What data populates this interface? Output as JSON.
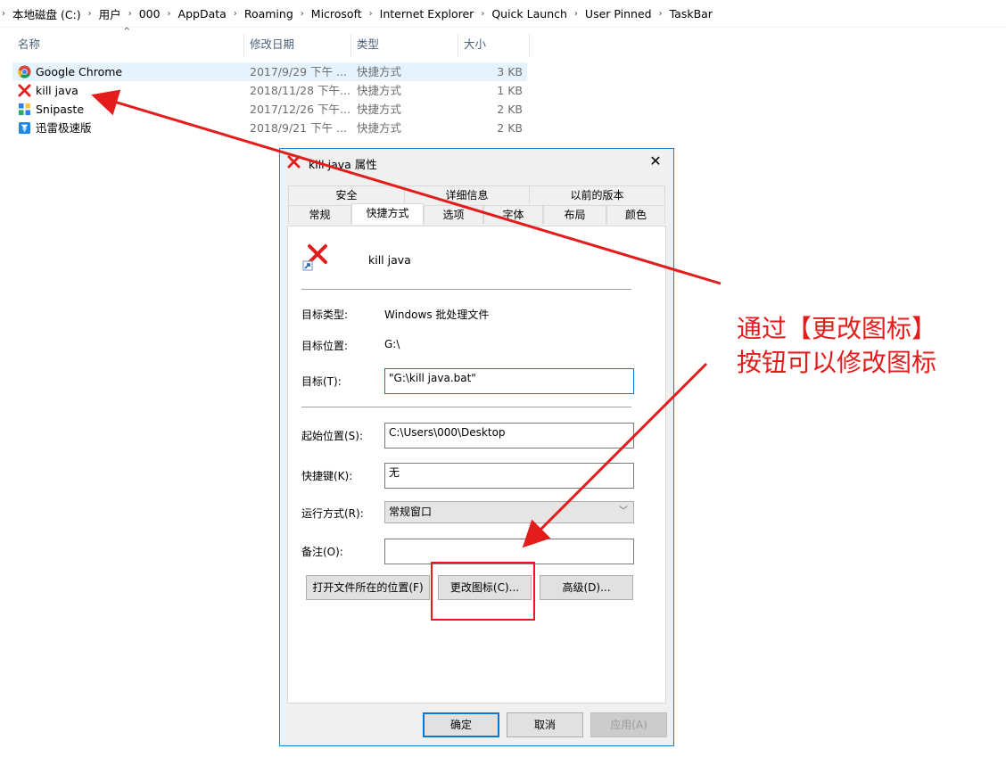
{
  "breadcrumb": [
    "本地磁盘 (C:)",
    "用户",
    "000",
    "AppData",
    "Roaming",
    "Microsoft",
    "Internet Explorer",
    "Quick Launch",
    "User Pinned",
    "TaskBar"
  ],
  "columns": {
    "name": "名称",
    "date": "修改日期",
    "type": "类型",
    "size": "大小"
  },
  "files": [
    {
      "name": "Google Chrome",
      "date": "2017/9/29 下午 ...",
      "type": "快捷方式",
      "size": "3 KB",
      "icon": "chrome-icon"
    },
    {
      "name": "kill java",
      "date": "2018/11/28 下午...",
      "type": "快捷方式",
      "size": "1 KB",
      "icon": "red-x-icon"
    },
    {
      "name": "Snipaste",
      "date": "2017/12/26 下午...",
      "type": "快捷方式",
      "size": "2 KB",
      "icon": "snipaste-icon"
    },
    {
      "name": "迅雷极速版",
      "date": "2018/9/21 下午 ...",
      "type": "快捷方式",
      "size": "2 KB",
      "icon": "xunlei-icon"
    }
  ],
  "dialog": {
    "title": "kill java 属性",
    "tabs_row1": [
      "安全",
      "详细信息",
      "以前的版本"
    ],
    "tabs_row2": [
      "常规",
      "快捷方式",
      "选项",
      "字体",
      "布局",
      "颜色"
    ],
    "active_tab": "快捷方式",
    "shortcut_name": "kill java",
    "target_type_label": "目标类型:",
    "target_type_value": "Windows 批处理文件",
    "target_location_label": "目标位置:",
    "target_location_value": "G:\\",
    "target_label": "目标(T):",
    "target_value": "\"G:\\kill java.bat\"",
    "start_in_label": "起始位置(S):",
    "start_in_value": "C:\\Users\\000\\Desktop",
    "hotkey_label": "快捷键(K):",
    "hotkey_value": "无",
    "run_label": "运行方式(R):",
    "run_value": "常规窗口",
    "comment_label": "备注(O):",
    "comment_value": "",
    "open_location_button": "打开文件所在的位置(F)",
    "change_icon_button": "更改图标(C)...",
    "advanced_button": "高级(D)...",
    "ok_button": "确定",
    "cancel_button": "取消",
    "apply_button": "应用(A)"
  },
  "annotation": {
    "line1": "通过【更改图标】",
    "line2": "按钮可以修改图标",
    "color": "#e31c1c"
  },
  "colors": {
    "selection": "#e5f3ff",
    "accent": "#0078d7",
    "annotation_red": "#e31c1c"
  }
}
